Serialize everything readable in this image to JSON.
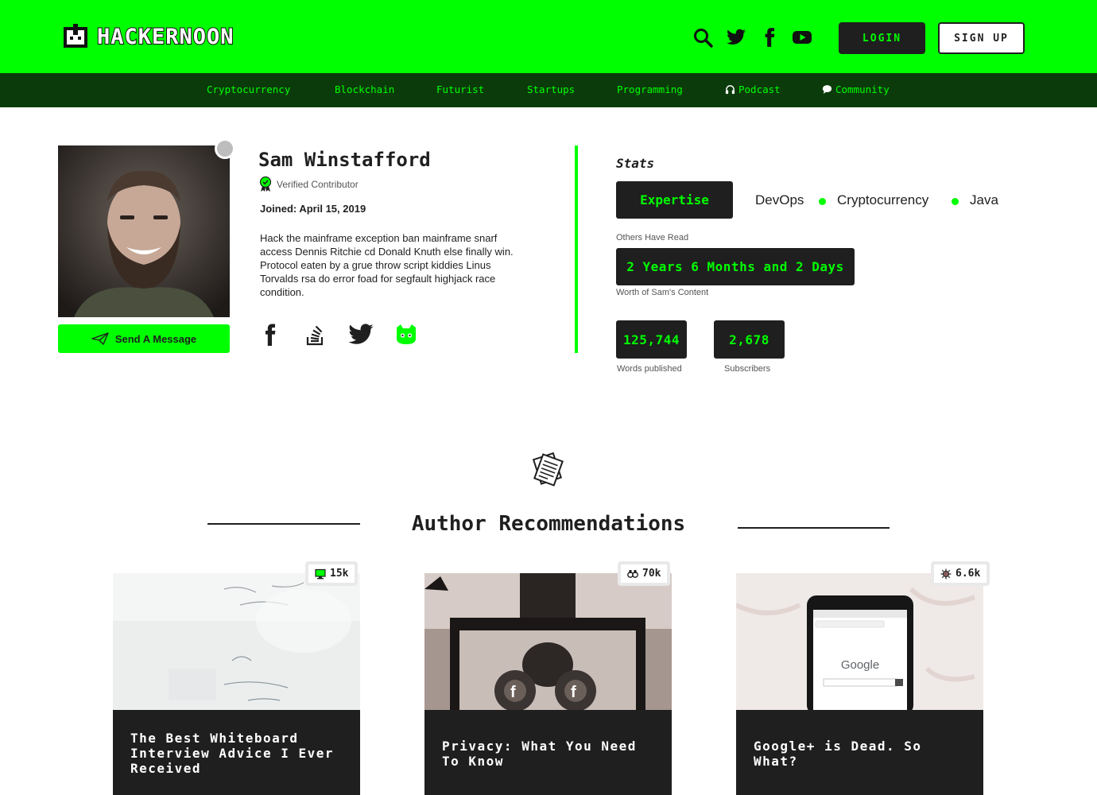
{
  "brand": {
    "name": "HACKERNOON"
  },
  "header": {
    "icons": [
      "search-icon",
      "twitter-icon",
      "facebook-icon",
      "youtube-icon"
    ],
    "login_label": "LOGIN",
    "signup_label": "SIGN UP"
  },
  "nav": {
    "items": [
      {
        "label": "Cryptocurrency"
      },
      {
        "label": "Blockchain"
      },
      {
        "label": "Futurist"
      },
      {
        "label": "Startups"
      },
      {
        "label": "Programming"
      },
      {
        "label": "Podcast",
        "icon": "headphones-icon"
      },
      {
        "label": "Community",
        "icon": "chat-icon"
      }
    ]
  },
  "profile": {
    "name": "Sam Winstafford",
    "verified_label": "Verified Contributor",
    "joined": "Joined: April 15, 2019",
    "bio": "Hack the mainframe exception ban mainframe snarf access Dennis Ritchie cd Donald Knuth else finally win. Protocol eaten by a grue throw script kiddies Linus Torvalds rsa do error foad for segfault highjack race condition.",
    "send_message_label": "Send A Message",
    "social": [
      "facebook-icon",
      "stackoverflow-icon",
      "twitter-icon",
      "github-icon"
    ]
  },
  "stats": {
    "title": "Stats",
    "expertise_label": "Expertise",
    "tags": [
      "DevOps",
      "Cryptocurrency",
      "Java"
    ],
    "others_have_read_label": "Others Have Read",
    "worth_value": "2 Years 6 Months and 2 Days",
    "worth_caption": "Worth of Sam's Content",
    "words_value": "125,744",
    "words_label": "Words published",
    "subscribers_value": "2,678",
    "subscribers_label": "Subscribers"
  },
  "recommendations": {
    "title": "Author Recommendations",
    "cards": [
      {
        "title": "The Best Whiteboard Interview Advice I Ever Received",
        "count": "15k",
        "badge_icon": "monitor-icon"
      },
      {
        "title": "Privacy: What You Need To Know",
        "count": "70k",
        "badge_icon": "binoculars-icon"
      },
      {
        "title": "Google+ is Dead. So What?",
        "count": "6.6k",
        "badge_icon": "virus-icon"
      }
    ]
  },
  "colors": {
    "accent": "#00ff00",
    "nav_bg": "#0b3b0b",
    "dark": "#1f1f1f"
  }
}
